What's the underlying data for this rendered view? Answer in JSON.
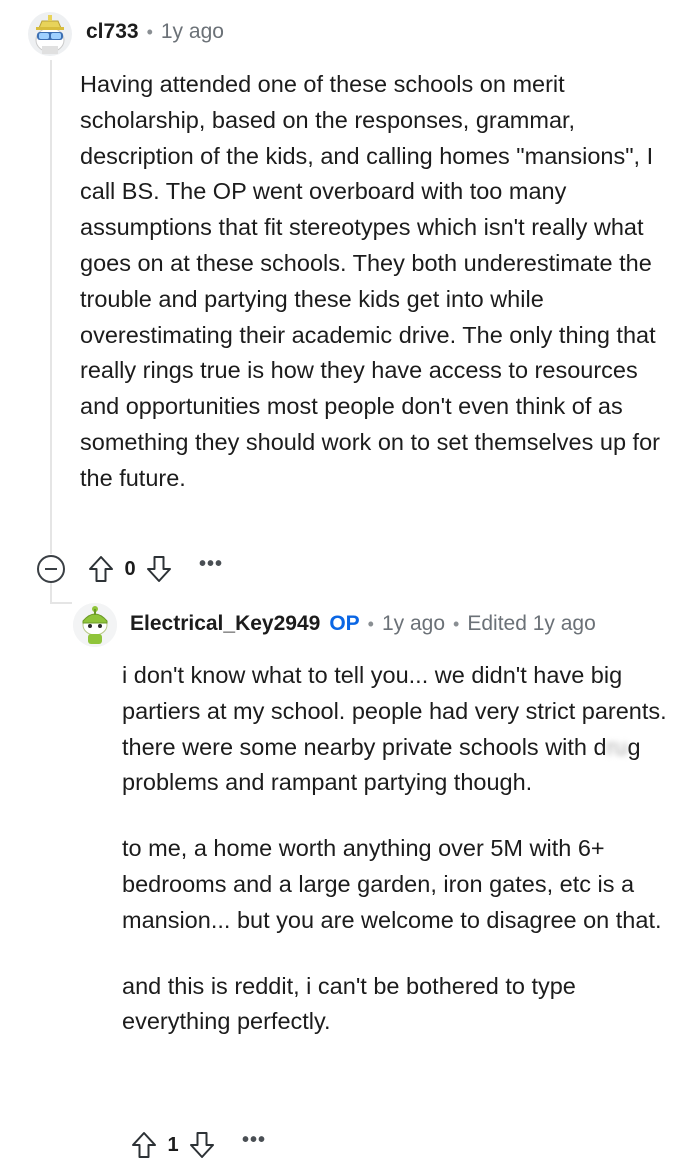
{
  "comment": {
    "username": "cl733",
    "separator": "•",
    "time": "1y ago",
    "body": "Having attended one of these schools on merit scholarship, based on the responses, grammar, description of the kids, and calling homes \"mansions\", I call BS. The OP went overboard with too many assumptions that fit stereotypes which isn't really what goes on at these schools. They both underestimate the trouble and partying these kids get into while overestimating their academic drive. The only thing that really rings true is how they have access to resources and opportunities most people don't even think of as something they should work on to set themselves up for the future.",
    "score": "0",
    "more": "•••"
  },
  "reply": {
    "username": "Electrical_Key2949",
    "op_badge": "OP",
    "separator": "•",
    "time": "1y ago",
    "separator2": "•",
    "edited": "Edited 1y ago",
    "p1_before": "i don't know what to tell you... we didn't have big partiers at my school. people had very strict parents. there were some nearby private schools with d",
    "p1_blur": "ru",
    "p1_after": "g problems and rampant partying though.",
    "p2": "to me, a home worth anything over 5M with 6+ bedrooms and a large garden, iron gates, etc is a mansion... but you are welcome to disagree on that.",
    "p3": "and this is reddit, i can't be bothered to type everything perfectly.",
    "score": "1",
    "more": "•••"
  },
  "icons": {
    "avatar_1": "snoo-avatar-with-hat",
    "avatar_2": "snoo-avatar-green",
    "upvote": "upvote-arrow-icon",
    "downvote": "downvote-arrow-icon",
    "collapse": "collapse-minus-icon",
    "more": "more-options-icon"
  }
}
